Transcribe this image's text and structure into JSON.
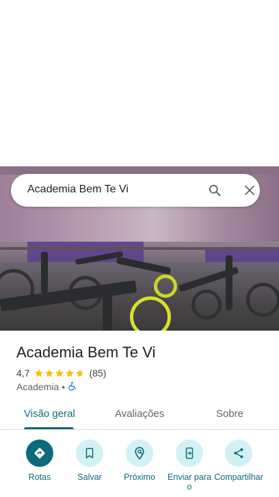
{
  "search": {
    "query": "Academia Bem Te Vi"
  },
  "place": {
    "name": "Academia Bem Te Vi",
    "rating": "4,7",
    "rating_value": 4.7,
    "review_count": "(85)",
    "category": "Academia",
    "separator": "•"
  },
  "tabs": [
    {
      "label": "Visão geral"
    },
    {
      "label": "Avaliações"
    },
    {
      "label": "Sobre"
    }
  ],
  "actions": [
    {
      "label": "Rotas",
      "icon": "directions-icon"
    },
    {
      "label": "Salvar",
      "icon": "bookmark-icon"
    },
    {
      "label": "Próximo",
      "icon": "nearby-icon"
    },
    {
      "label": "Enviar para o",
      "icon": "send-to-phone-icon"
    },
    {
      "label": "Compartilhar",
      "icon": "share-icon"
    }
  ],
  "colors": {
    "accent": "#0b6b7a",
    "accent_light": "#d2f1f4",
    "star": "#fbbc04",
    "accessible_icon": "#1a73e8"
  }
}
